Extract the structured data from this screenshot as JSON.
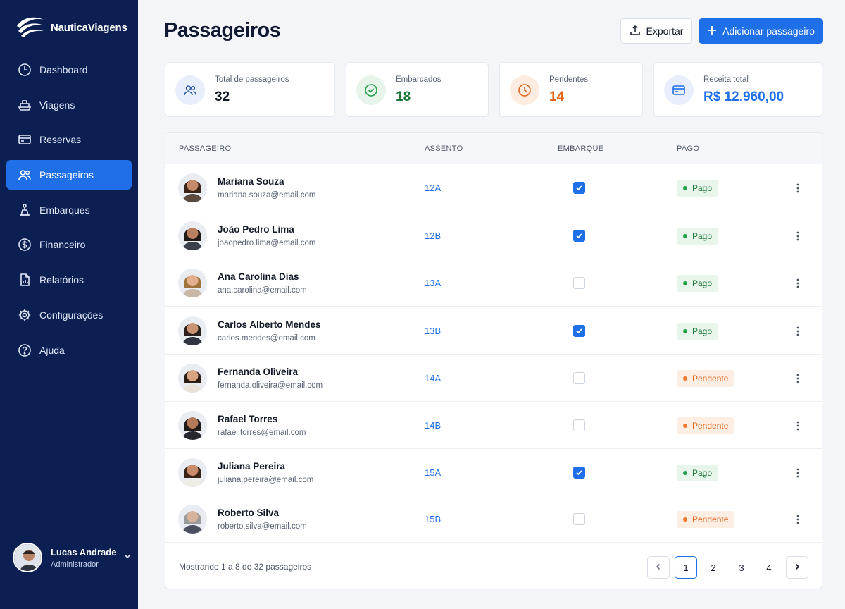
{
  "brand": {
    "name": "NauticaViagens"
  },
  "sidebar": {
    "items": [
      {
        "label": "Dashboard",
        "icon": "dashboard-clock-icon",
        "active": false
      },
      {
        "label": "Viagens",
        "icon": "ship-icon",
        "active": false
      },
      {
        "label": "Reservas",
        "icon": "card-icon",
        "active": false
      },
      {
        "label": "Passageiros",
        "icon": "users-icon",
        "active": true
      },
      {
        "label": "Embarques",
        "icon": "boarding-icon",
        "active": false
      },
      {
        "label": "Financeiro",
        "icon": "dollar-icon",
        "active": false
      },
      {
        "label": "Relatórios",
        "icon": "report-icon",
        "active": false
      },
      {
        "label": "Configurações",
        "icon": "gear-icon",
        "active": false
      },
      {
        "label": "Ajuda",
        "icon": "help-icon",
        "active": false
      }
    ],
    "user": {
      "name": "Lucas Andrade",
      "role": "Administrador"
    }
  },
  "header": {
    "title": "Passageiros",
    "export_label": "Exportar",
    "add_label": "Adicionar passageiro"
  },
  "stats": [
    {
      "label": "Total de passageiros",
      "value": "32",
      "color": "#111827",
      "icon": "users-icon",
      "icon_bg": "#e8eefb",
      "icon_color": "#2f5ca8"
    },
    {
      "label": "Embarcados",
      "value": "18",
      "color": "#1d7a3b",
      "icon": "check-circle-icon",
      "icon_bg": "#e6f4ea",
      "icon_color": "#22a04a"
    },
    {
      "label": "Pendentes",
      "value": "14",
      "color": "#e4661d",
      "icon": "clock-icon",
      "icon_bg": "#fdecdf",
      "icon_color": "#e4661d"
    },
    {
      "label": "Receita total",
      "value": "R$ 12.960,00",
      "color": "#1f6fe8",
      "icon": "credit-card-icon",
      "icon_bg": "#e8eefb",
      "icon_color": "#1f6fe8"
    }
  ],
  "table": {
    "columns": [
      "PASSAGEIRO",
      "ASSENTO",
      "EMBARQUE",
      "PAGO"
    ],
    "rows": [
      {
        "name": "Mariana Souza",
        "email": "mariana.souza@email.com",
        "seat": "12A",
        "boarded": true,
        "paid_status": "Pago"
      },
      {
        "name": "João Pedro Lima",
        "email": "joaopedro.lima@email.com",
        "seat": "12B",
        "boarded": true,
        "paid_status": "Pago"
      },
      {
        "name": "Ana Carolina Dias",
        "email": "ana.carolina@email.com",
        "seat": "13A",
        "boarded": false,
        "paid_status": "Pago"
      },
      {
        "name": "Carlos Alberto Mendes",
        "email": "carlos.mendes@email.com",
        "seat": "13B",
        "boarded": true,
        "paid_status": "Pago"
      },
      {
        "name": "Fernanda Oliveira",
        "email": "fernanda.oliveira@email.com",
        "seat": "14A",
        "boarded": false,
        "paid_status": "Pendente"
      },
      {
        "name": "Rafael Torres",
        "email": "rafael.torres@email.com",
        "seat": "14B",
        "boarded": false,
        "paid_status": "Pendente"
      },
      {
        "name": "Juliana Pereira",
        "email": "juliana.pereira@email.com",
        "seat": "15A",
        "boarded": true,
        "paid_status": "Pago"
      },
      {
        "name": "Roberto Silva",
        "email": "roberto.silva@email.com",
        "seat": "15B",
        "boarded": false,
        "paid_status": "Pendente"
      }
    ],
    "footer_text": "Mostrando 1 a 8 de 32 passageiros",
    "pages": [
      "1",
      "2",
      "3",
      "4"
    ],
    "current_page": "1"
  },
  "colors": {
    "sidebar_bg": "#0b1f52",
    "accent": "#1f6fe8",
    "paid": "#1d7a3b",
    "pending": "#e4661d"
  }
}
